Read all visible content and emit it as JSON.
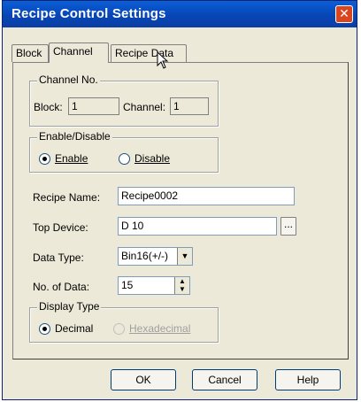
{
  "window": {
    "title": "Recipe Control Settings"
  },
  "tabs": [
    {
      "label": "Block"
    },
    {
      "label": "Channel"
    },
    {
      "label": "Recipe Data"
    }
  ],
  "channel_no": {
    "legend": "Channel No.",
    "block_label": "Block:",
    "block_value": "1",
    "channel_label": "Channel:",
    "channel_value": "1"
  },
  "enable_disable": {
    "legend": "Enable/Disable",
    "enable_label": "Enable",
    "disable_label": "Disable",
    "selected": "Enable"
  },
  "form": {
    "recipe_name_label": "Recipe Name:",
    "recipe_name_value": "Recipe0002",
    "top_device_label": "Top Device:",
    "top_device_value": "D 10",
    "browse_label": "...",
    "data_type_label": "Data Type:",
    "data_type_value": "Bin16(+/-)",
    "no_of_data_label": "No. of Data:",
    "no_of_data_value": "15"
  },
  "display_type": {
    "legend": "Display Type",
    "decimal_label": "Decimal",
    "hex_label": "Hexadecimal",
    "selected": "Decimal"
  },
  "buttons": {
    "ok": "OK",
    "cancel": "Cancel",
    "help": "Help"
  },
  "icons": {
    "close": "close-icon",
    "dropdown": "chevron-down-icon",
    "spin": "spin-arrows-icon",
    "cursor": "mouse-cursor-icon"
  },
  "colors": {
    "titlebar": "#0a5ed8",
    "close": "#d9451f",
    "dialog_bg": "#ece9d8"
  }
}
